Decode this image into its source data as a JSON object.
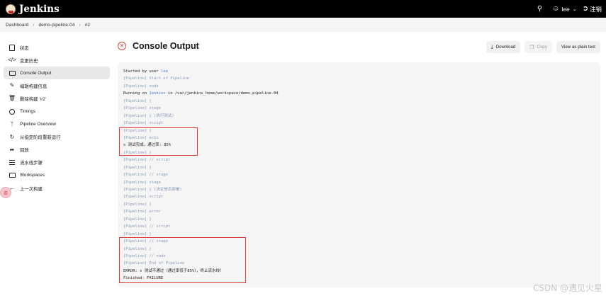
{
  "header": {
    "app_name": "Jenkins",
    "search_icon": "search-icon",
    "username": "lee",
    "logout_label": "注销"
  },
  "breadcrumb": [
    "Dashboard",
    "demo-pipeline-04",
    "#2"
  ],
  "sidebar": {
    "items": [
      {
        "label": "状态",
        "icon": "document-icon"
      },
      {
        "label": "变更历史",
        "icon": "code-icon"
      },
      {
        "label": "Console Output",
        "icon": "terminal-icon",
        "active": true
      },
      {
        "label": "编辑构建信息",
        "icon": "edit-icon"
      },
      {
        "label": "删除构建 '#2'",
        "icon": "trash-icon"
      },
      {
        "label": "Timings",
        "icon": "clock-icon"
      },
      {
        "label": "Pipeline Overview",
        "icon": "pipeline-icon"
      },
      {
        "label": "从指定阶段重新运行",
        "icon": "rerun-icon"
      },
      {
        "label": "回放",
        "icon": "replay-icon"
      },
      {
        "label": "流水线步骤",
        "icon": "steps-icon"
      },
      {
        "label": "Workspaces",
        "icon": "folder-icon"
      },
      {
        "label": "上一次构建",
        "icon": "previous-build-icon"
      }
    ],
    "float_badge": "荔"
  },
  "main": {
    "title": "Console Output",
    "status_icon": "failure-icon",
    "buttons": {
      "download": "Download",
      "copy": "Copy",
      "plain_text": "View as plain text"
    },
    "console_lines": [
      {
        "t": "plain-user",
        "pre": "Started by user ",
        "link": "lee"
      },
      {
        "t": "pl",
        "text": "[Pipeline] Start of Pipeline"
      },
      {
        "t": "pl",
        "text": "[Pipeline] node"
      },
      {
        "t": "plain-node",
        "pre": "Running on ",
        "link": "Jenkins",
        "post": " in /var/jenkins_home/workspace/demo-pipeline-04"
      },
      {
        "t": "pl",
        "text": "[Pipeline] {"
      },
      {
        "t": "pl",
        "text": "[Pipeline] stage"
      },
      {
        "t": "pl",
        "text": "[Pipeline] { (执行测试)"
      },
      {
        "t": "pl",
        "text": "[Pipeline] script"
      },
      {
        "t": "pl",
        "text": "[Pipeline] {"
      },
      {
        "t": "pl",
        "text": "[Pipeline] echo"
      },
      {
        "t": "plain",
        "text": "s 测试完成，通过率: 85%"
      },
      {
        "t": "pl",
        "text": "[Pipeline] }"
      },
      {
        "t": "pl",
        "text": "[Pipeline] // script"
      },
      {
        "t": "pl",
        "text": "[Pipeline] }"
      },
      {
        "t": "pl",
        "text": "[Pipeline] // stage"
      },
      {
        "t": "pl",
        "text": "[Pipeline] stage"
      },
      {
        "t": "pl",
        "text": "[Pipeline] { (決定是否部署)"
      },
      {
        "t": "pl",
        "text": "[Pipeline] script"
      },
      {
        "t": "pl",
        "text": "[Pipeline] {"
      },
      {
        "t": "pl",
        "text": "[Pipeline] error"
      },
      {
        "t": "pl",
        "text": "[Pipeline] }"
      },
      {
        "t": "pl",
        "text": "[Pipeline] // script"
      },
      {
        "t": "pl",
        "text": "[Pipeline] }"
      },
      {
        "t": "pl",
        "text": "[Pipeline] // stage"
      },
      {
        "t": "pl",
        "text": "[Pipeline] }"
      },
      {
        "t": "pl",
        "text": "[Pipeline] // node"
      },
      {
        "t": "pl",
        "text": "[Pipeline] End of Pipeline"
      },
      {
        "t": "plain",
        "text": "ERROR: s 测试不通过（通过率低于85%），终止流水线！"
      },
      {
        "t": "plain",
        "text": "Finished: FAILURE"
      }
    ]
  },
  "watermark": "CSDN @遇见火星",
  "colors": {
    "header_bg": "#000000",
    "failure": "#d24939",
    "pipeline_text": "#8a9bb8",
    "link": "#4a7ac9",
    "highlight": "#e23b3b"
  }
}
